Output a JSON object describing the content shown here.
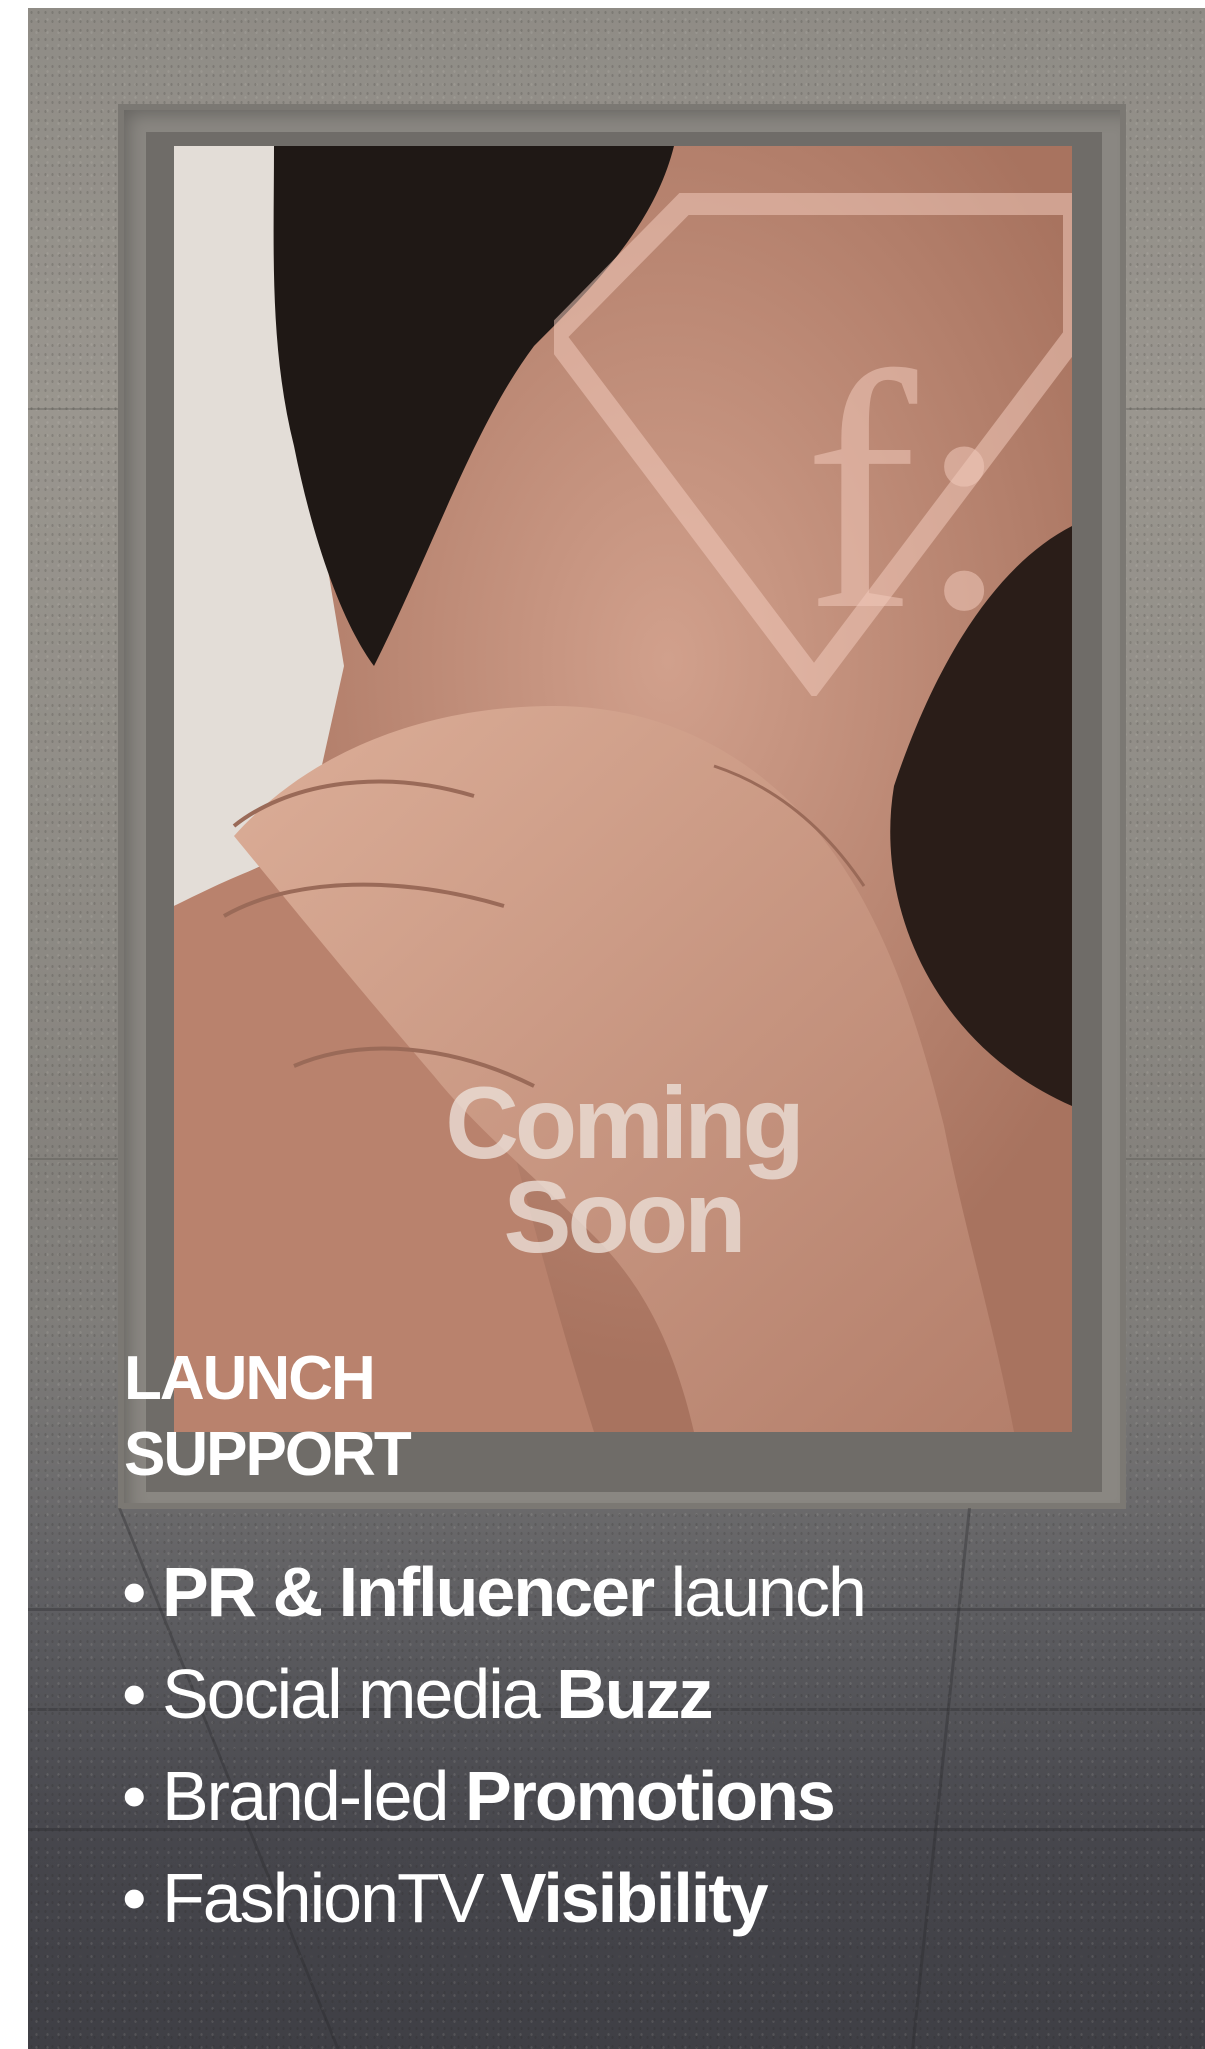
{
  "poster": {
    "logo_letter": "f:",
    "headline_line1": "Coming",
    "headline_line2": "Soon"
  },
  "section": {
    "title_line1": "LAUNCH",
    "title_line2": "SUPPORT"
  },
  "bullets": [
    {
      "bold": "PR & Influencer",
      "regular": " launch",
      "bold_first": true
    },
    {
      "regular": "Social media ",
      "bold": "Buzz",
      "bold_first": false
    },
    {
      "regular": "Brand-led ",
      "bold": "Promotions",
      "bold_first": false
    },
    {
      "regular": "FashionTV ",
      "bold": "Visibility",
      "bold_first": false
    }
  ],
  "bullet_glyph": "•",
  "colors": {
    "text": "#ffffff",
    "logo_tint": "#f0c9b9"
  }
}
